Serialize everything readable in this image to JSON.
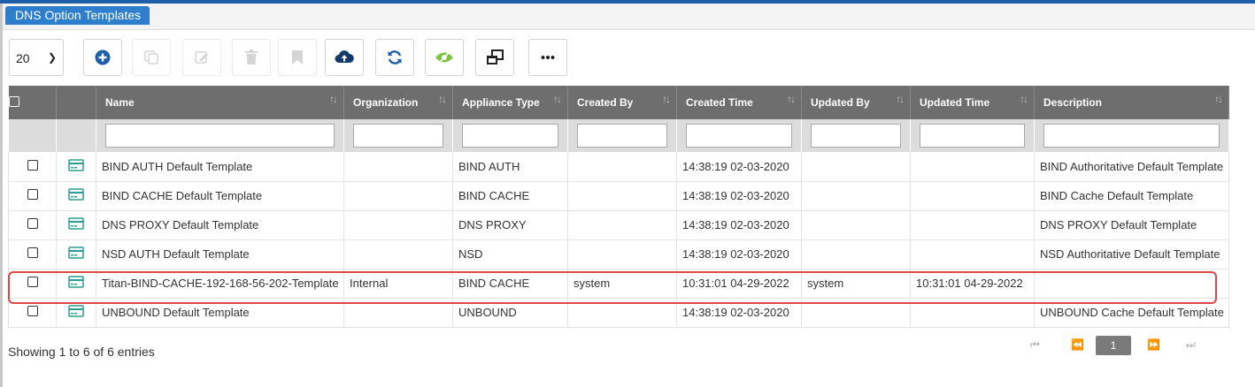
{
  "header": {
    "title": "DNS Option Templates"
  },
  "toolbar": {
    "page_size": "20",
    "buttons": [
      {
        "id": "add",
        "icon": "plus-circle-icon",
        "enabled": true
      },
      {
        "id": "copy",
        "icon": "copy-icon",
        "enabled": false
      },
      {
        "id": "edit",
        "icon": "edit-icon",
        "enabled": false
      },
      {
        "id": "delete",
        "icon": "trash-icon",
        "enabled": false
      },
      {
        "id": "bookmark",
        "icon": "bookmark-icon",
        "enabled": false
      },
      {
        "id": "upload",
        "icon": "cloud-upload-icon",
        "enabled": true
      },
      {
        "id": "refresh",
        "icon": "refresh-icon",
        "enabled": true
      },
      {
        "id": "visibility",
        "icon": "eye-icon",
        "enabled": true
      },
      {
        "id": "windows",
        "icon": "windows-icon",
        "enabled": true
      },
      {
        "id": "more",
        "icon": "more-icon",
        "enabled": true
      }
    ]
  },
  "table": {
    "columns": [
      "Name",
      "Organization",
      "Appliance Type",
      "Created By",
      "Created Time",
      "Updated By",
      "Updated Time",
      "Description"
    ],
    "rows": [
      {
        "name": "BIND AUTH Default Template",
        "organization": "",
        "appliance_type": "BIND AUTH",
        "created_by": "",
        "created_time": "14:38:19 02-03-2020",
        "updated_by": "",
        "updated_time": "",
        "description": "BIND Authoritative Default Template"
      },
      {
        "name": "BIND CACHE Default Template",
        "organization": "",
        "appliance_type": "BIND CACHE",
        "created_by": "",
        "created_time": "14:38:19 02-03-2020",
        "updated_by": "",
        "updated_time": "",
        "description": "BIND Cache Default Template"
      },
      {
        "name": "DNS PROXY Default Template",
        "organization": "",
        "appliance_type": "DNS PROXY",
        "created_by": "",
        "created_time": "14:38:19 02-03-2020",
        "updated_by": "",
        "updated_time": "",
        "description": "DNS PROXY Default Template"
      },
      {
        "name": "NSD AUTH Default Template",
        "organization": "",
        "appliance_type": "NSD",
        "created_by": "",
        "created_time": "14:38:19 02-03-2020",
        "updated_by": "",
        "updated_time": "",
        "description": "NSD Authoritative Default Template"
      },
      {
        "name": "Titan-BIND-CACHE-192-168-56-202-Template",
        "organization": "Internal",
        "appliance_type": "BIND CACHE",
        "created_by": "system",
        "created_time": "10:31:01 04-29-2022",
        "updated_by": "system",
        "updated_time": "10:31:01 04-29-2022",
        "description": ""
      },
      {
        "name": "UNBOUND Default Template",
        "organization": "",
        "appliance_type": "UNBOUND",
        "created_by": "",
        "created_time": "14:38:19 02-03-2020",
        "updated_by": "",
        "updated_time": "",
        "description": "UNBOUND Cache Default Template"
      }
    ]
  },
  "footer": {
    "summary": "Showing 1 to 6 of 6 entries",
    "current_page": "1"
  },
  "colors": {
    "accent": "#2d7fcc",
    "header_bg": "#6e6e6e",
    "highlight": "#e04848",
    "link": "#1a3fb0"
  }
}
